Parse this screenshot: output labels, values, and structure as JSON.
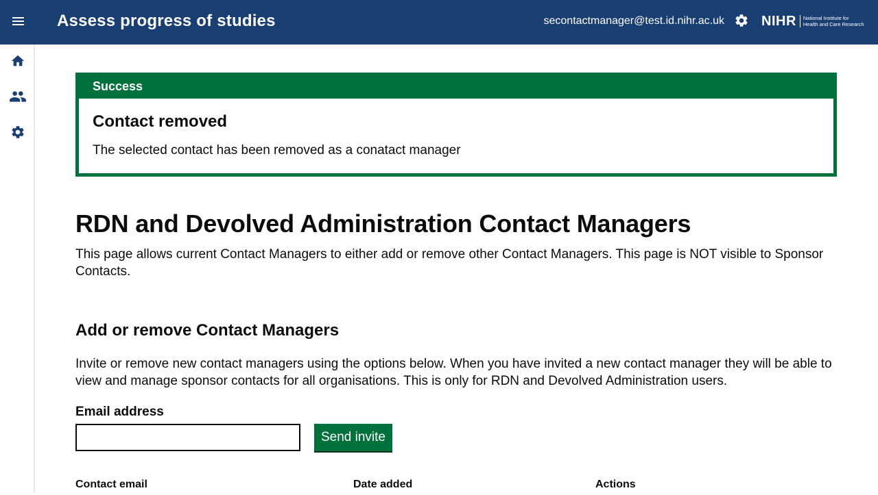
{
  "header": {
    "title": "Assess progress of studies",
    "user_email": "secontactmanager@test.id.nihr.ac.uk",
    "logo_mark": "NIHR",
    "logo_line1": "National Institute for",
    "logo_line2": "Health and Care Research",
    "menu_icon": "hamburger-menu-icon",
    "settings_icon": "gear-icon"
  },
  "sidebar": {
    "items": [
      {
        "icon": "home-icon"
      },
      {
        "icon": "people-icon"
      },
      {
        "icon": "gear-icon"
      }
    ]
  },
  "banner": {
    "heading": "Success",
    "title": "Contact removed",
    "text": "The selected contact has been removed as a conatact manager"
  },
  "page": {
    "title": "RDN and Devolved Administration Contact Managers",
    "intro": "This page allows current Contact Managers to either add or remove other Contact Managers. This page is NOT visible to Sponsor Contacts."
  },
  "section": {
    "title": "Add or remove Contact Managers",
    "text": "Invite or remove new contact managers using the options below. When you have invited a new contact manager they will be able to view and manage sponsor contacts for all organisations. This is only for RDN and Devolved Administration users."
  },
  "form": {
    "email_label": "Email address",
    "email_value": "",
    "send_label": "Send invite"
  },
  "table": {
    "columns": [
      "Contact email",
      "Date added",
      "Actions"
    ]
  },
  "colors": {
    "header_bg": "#193e72",
    "success_green": "#00703c",
    "text": "#0b0c0c"
  }
}
